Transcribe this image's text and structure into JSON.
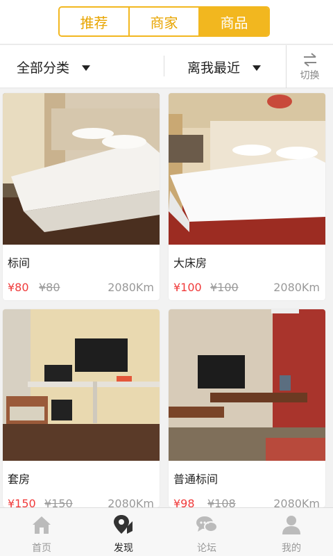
{
  "segment": {
    "tabs": [
      {
        "label": "推荐",
        "active": false
      },
      {
        "label": "商家",
        "active": false
      },
      {
        "label": "商品",
        "active": true
      }
    ],
    "accent_color": "#f2b71f"
  },
  "filters": {
    "category": "全部分类",
    "sort": "离我最近",
    "switch_label": "切换"
  },
  "products": [
    {
      "name": "标间",
      "price": "¥80",
      "old_price": "¥80",
      "distance": "2080Km"
    },
    {
      "name": "大床房",
      "price": "¥100",
      "old_price": "¥100",
      "distance": "2080Km"
    },
    {
      "name": "套房",
      "price": "¥150",
      "old_price": "¥150",
      "distance": "2080Km"
    },
    {
      "name": "普通标间",
      "price": "¥98",
      "old_price": "¥108",
      "distance": "2080Km"
    }
  ],
  "price_color": "#f03a3a",
  "bottom_nav": [
    {
      "label": "首页",
      "icon": "home-icon",
      "active": false
    },
    {
      "label": "发现",
      "icon": "location-pin-icon",
      "active": true
    },
    {
      "label": "论坛",
      "icon": "chat-bubbles-icon",
      "active": false
    },
    {
      "label": "我的",
      "icon": "user-icon",
      "active": false
    }
  ]
}
